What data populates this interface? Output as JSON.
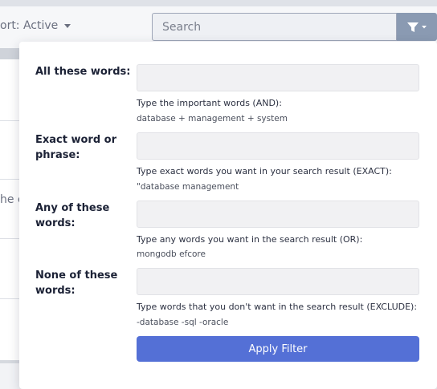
{
  "toolbar": {
    "sort_label": "ort: Active",
    "search_placeholder": "Search"
  },
  "background": {
    "list_fragment": "he c"
  },
  "filter_panel": {
    "fields": [
      {
        "label": "All these words:",
        "value": "",
        "hint": "Type the important words (AND):",
        "example": "database + management + system"
      },
      {
        "label": "Exact word or phrase:",
        "value": "",
        "hint": "Type exact words you want in your search result (EXACT):",
        "example": "\"database management"
      },
      {
        "label": "Any of these words:",
        "value": "",
        "hint": "Type any words you want in the search result (OR):",
        "example": "mongodb efcore"
      },
      {
        "label": "None of these words:",
        "value": "",
        "hint": "Type words that you don't want in the search result (EXCLUDE):",
        "example": "-database -sql -oracle"
      }
    ],
    "apply_label": "Apply Filter"
  },
  "icons": {
    "filter": "filter-icon",
    "caret": "chevron-down-icon"
  },
  "colors": {
    "accent": "#5470d6",
    "filter_button": "#8a9ab2",
    "input_bg": "#f1f1f3"
  }
}
